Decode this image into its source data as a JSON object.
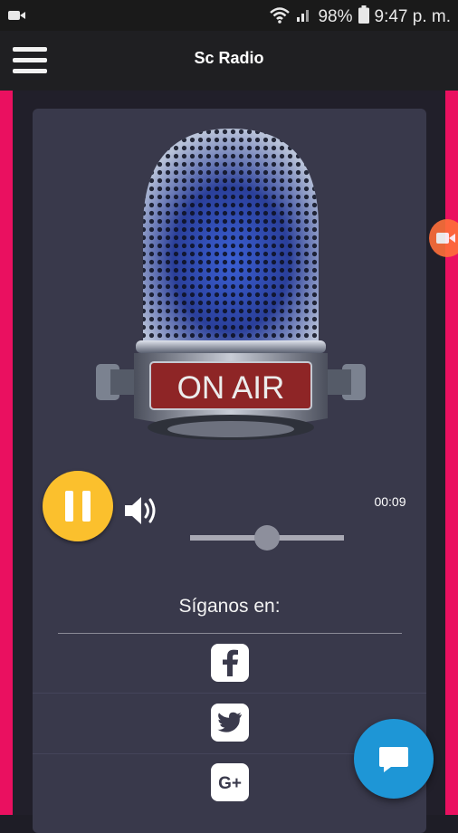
{
  "statusbar": {
    "battery": "98%",
    "time": "9:47 p. m."
  },
  "appbar": {
    "title": "Sc Radio"
  },
  "player": {
    "mic_label": "ON AIR",
    "elapsed": "00:09",
    "seek_fraction": 0.5
  },
  "social": {
    "heading": "Síganos en:",
    "gplus": "G+"
  },
  "colors": {
    "accent": "#ea1060",
    "play": "#fbc02d",
    "fab": "#1e96d6",
    "card": "#39394b"
  }
}
